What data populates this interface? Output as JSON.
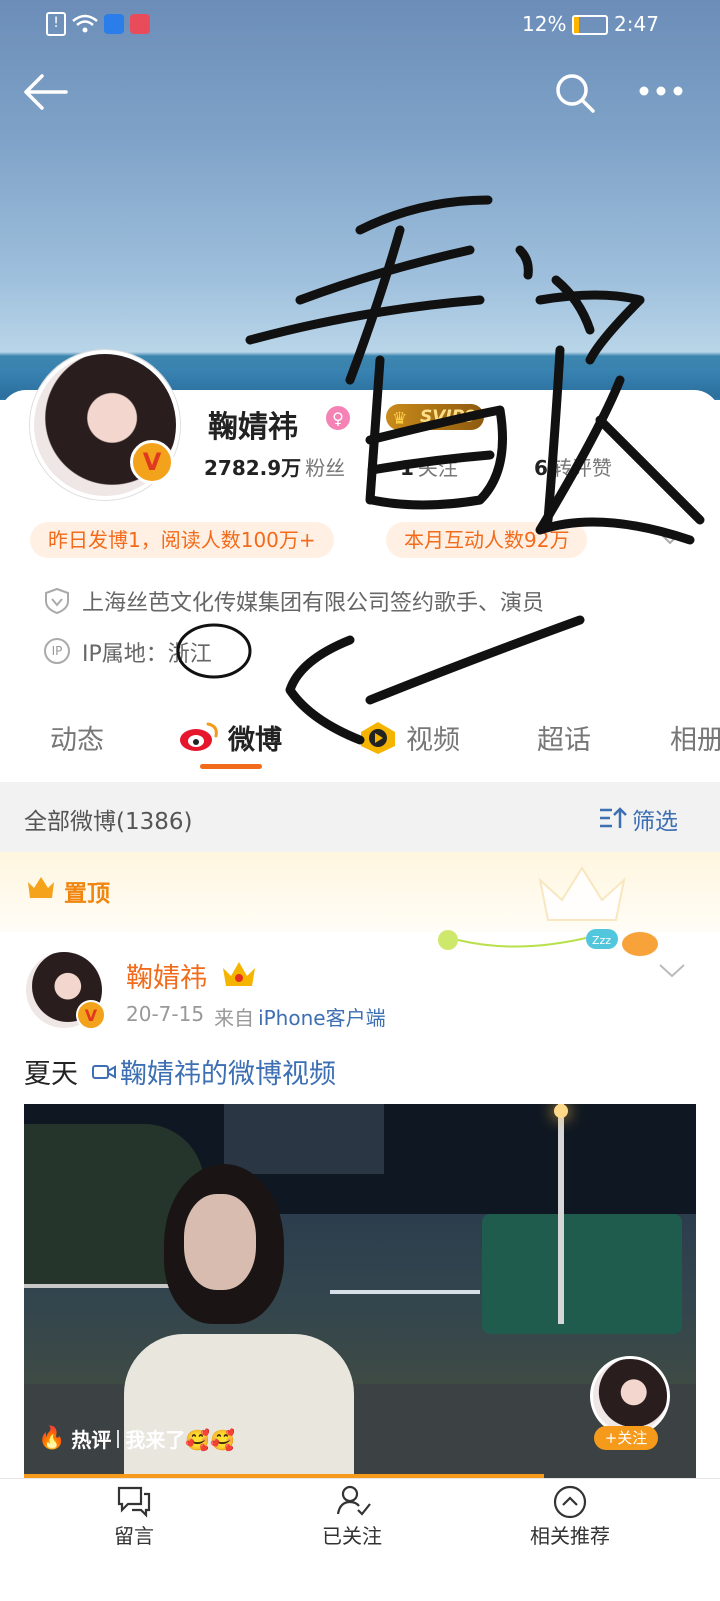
{
  "status_bar": {
    "battery": "12%",
    "time": "2:47"
  },
  "profile": {
    "name": "鞠婧祎",
    "vip_badge": "SVIP9",
    "stats": [
      {
        "value": "2782.9万",
        "label": "粉丝"
      },
      {
        "value": "1",
        "label": "关注"
      },
      {
        "value": "6",
        "label": "转评赞"
      }
    ],
    "highlights": [
      "昨日发博1，阅读人数100万+",
      "本月互动人数92万"
    ],
    "verification": "上海丝芭文化传媒集团有限公司签约歌手、演员",
    "ip_label": "IP属地：",
    "ip_value": "浙江"
  },
  "tabs": [
    "动态",
    "微博",
    "视频",
    "超话",
    "相册"
  ],
  "filter": {
    "count_label": "全部微博(1386)",
    "filter_label": "筛选"
  },
  "pinned_label": "置顶",
  "post": {
    "author": "鞠婧祎",
    "date": "20-7-15",
    "source_prefix": "来自",
    "source": "iPhone客户端",
    "text": "夏天",
    "video_link": "鞠婧祎的微博视频",
    "hot_comment_label": "热评",
    "hot_comment": "我来了🥰🥰",
    "follow_label": "+关注"
  },
  "bottom_bar": [
    "留言",
    "已关注",
    "相关推荐"
  ],
  "colors": {
    "accent": "#f26b1b",
    "link": "#3d6fb3",
    "vip_gold": "#c98b1a"
  }
}
